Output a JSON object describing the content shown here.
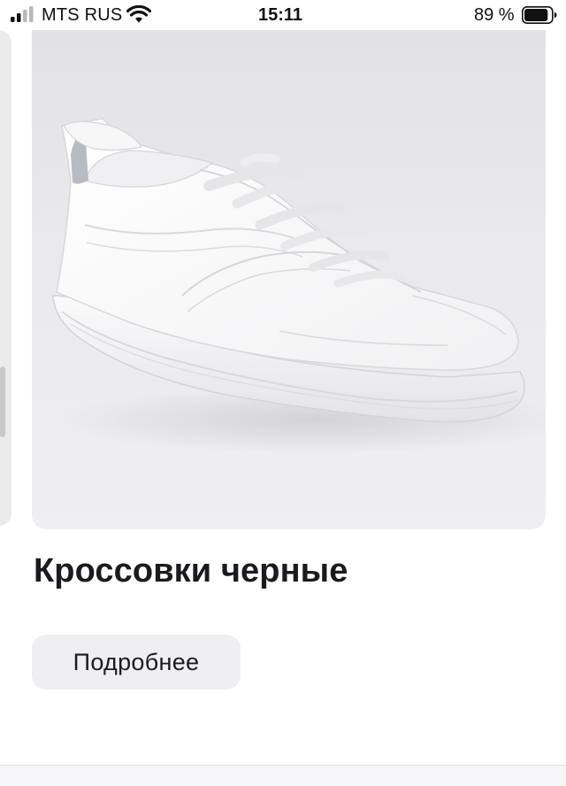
{
  "status_bar": {
    "carrier": "MTS RUS",
    "time": "15:11",
    "battery_percent": "89 %",
    "signal_icon": "signal-bars-icon",
    "wifi_icon": "wifi-icon",
    "battery_icon": "battery-icon",
    "battery_level": 0.89
  },
  "product": {
    "image_subject": "white-sneaker-image",
    "title": "Кроссовки черные",
    "details_button_label": "Подробнее"
  },
  "colors": {
    "background": "#ffffff",
    "title_text": "#1a1a1f",
    "button_background": "#efeff2",
    "image_background": "#e8e8ea"
  }
}
